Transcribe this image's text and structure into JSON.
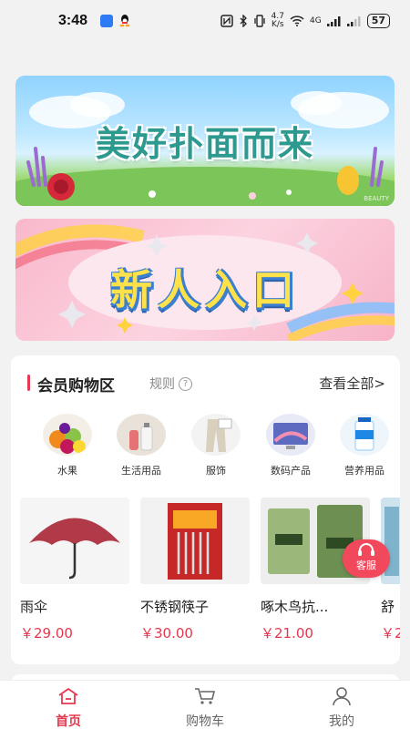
{
  "status_bar": {
    "time": "3:48",
    "network_speed": "4.7\nK/s",
    "network_type": "4G",
    "battery": "57",
    "icons": [
      "nfc-icon",
      "bluetooth-icon",
      "vibrate-icon",
      "wifi-icon",
      "signal-icon"
    ]
  },
  "banners": [
    {
      "text": "美好扑面而来",
      "watermark": "BEAUTY",
      "icon": "spring-flowers-banner"
    },
    {
      "text": "新人入口",
      "icon": "new-user-banner"
    }
  ],
  "member_section": {
    "title": "会员购物区",
    "rules_label": "规则",
    "view_all": "查看全部>",
    "categories": [
      {
        "label": "水果",
        "icon": "fruit-icon"
      },
      {
        "label": "生活用品",
        "icon": "daily-goods-icon"
      },
      {
        "label": "服饰",
        "icon": "clothing-icon"
      },
      {
        "label": "数码产品",
        "icon": "digital-icon"
      },
      {
        "label": "营养用品",
        "icon": "nutrition-icon"
      }
    ],
    "products": [
      {
        "name": "雨伞",
        "price": "￥29.00",
        "icon": "umbrella-image"
      },
      {
        "name": "不锈钢筷子",
        "price": "￥30.00",
        "icon": "chopsticks-image"
      },
      {
        "name": "啄木鸟抗...",
        "price": "￥21.00",
        "icon": "socks-image"
      },
      {
        "name": "舒",
        "price": "￥2",
        "icon": "product-image"
      }
    ]
  },
  "customer_service": {
    "label": "客服"
  },
  "tabbar": {
    "tabs": [
      {
        "label": "首页",
        "active": true,
        "icon": "home-icon"
      },
      {
        "label": "购物车",
        "active": false,
        "icon": "cart-icon"
      },
      {
        "label": "我的",
        "active": false,
        "icon": "profile-icon"
      }
    ]
  },
  "colors": {
    "accent": "#e5384f",
    "price": "#e5384f",
    "background": "#f2f2f2"
  }
}
